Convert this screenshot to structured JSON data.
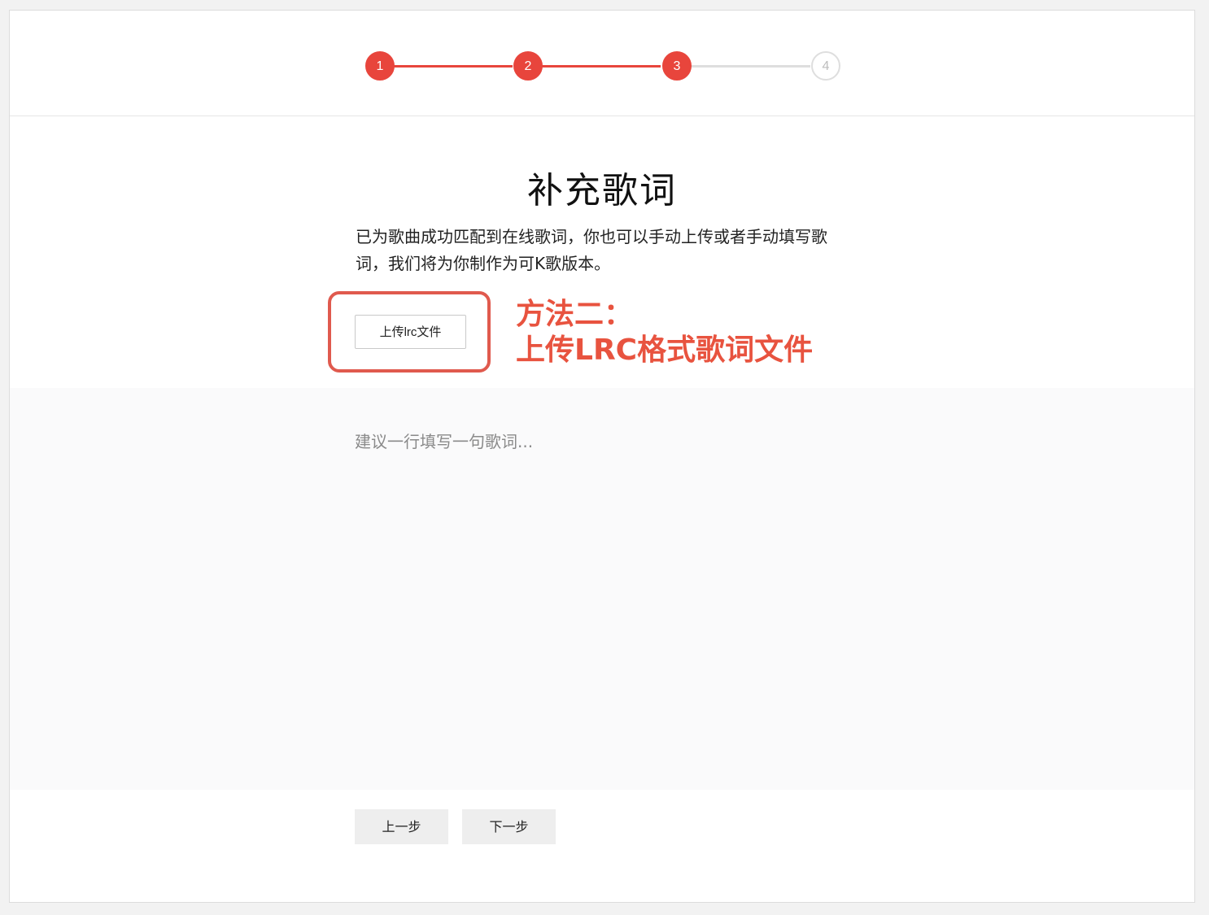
{
  "stepper": {
    "steps": [
      "1",
      "2",
      "3",
      "4"
    ],
    "current_step": 3,
    "colors": {
      "active": "#e8453c",
      "inactive": "#dedede"
    }
  },
  "page": {
    "title": "补充歌词",
    "description": "已为歌曲成功匹配到在线歌词，你也可以手动上传或者手动填写歌词，我们将为你制作为可K歌版本。"
  },
  "upload": {
    "button_label": "上传lrc文件"
  },
  "annotation": {
    "line1": "方法二：",
    "line2": "上传LRC格式歌词文件",
    "color": "#e8533f"
  },
  "lyrics": {
    "placeholder": "建议一行填写一句歌词...",
    "value": ""
  },
  "nav": {
    "prev_label": "上一步",
    "next_label": "下一步"
  }
}
